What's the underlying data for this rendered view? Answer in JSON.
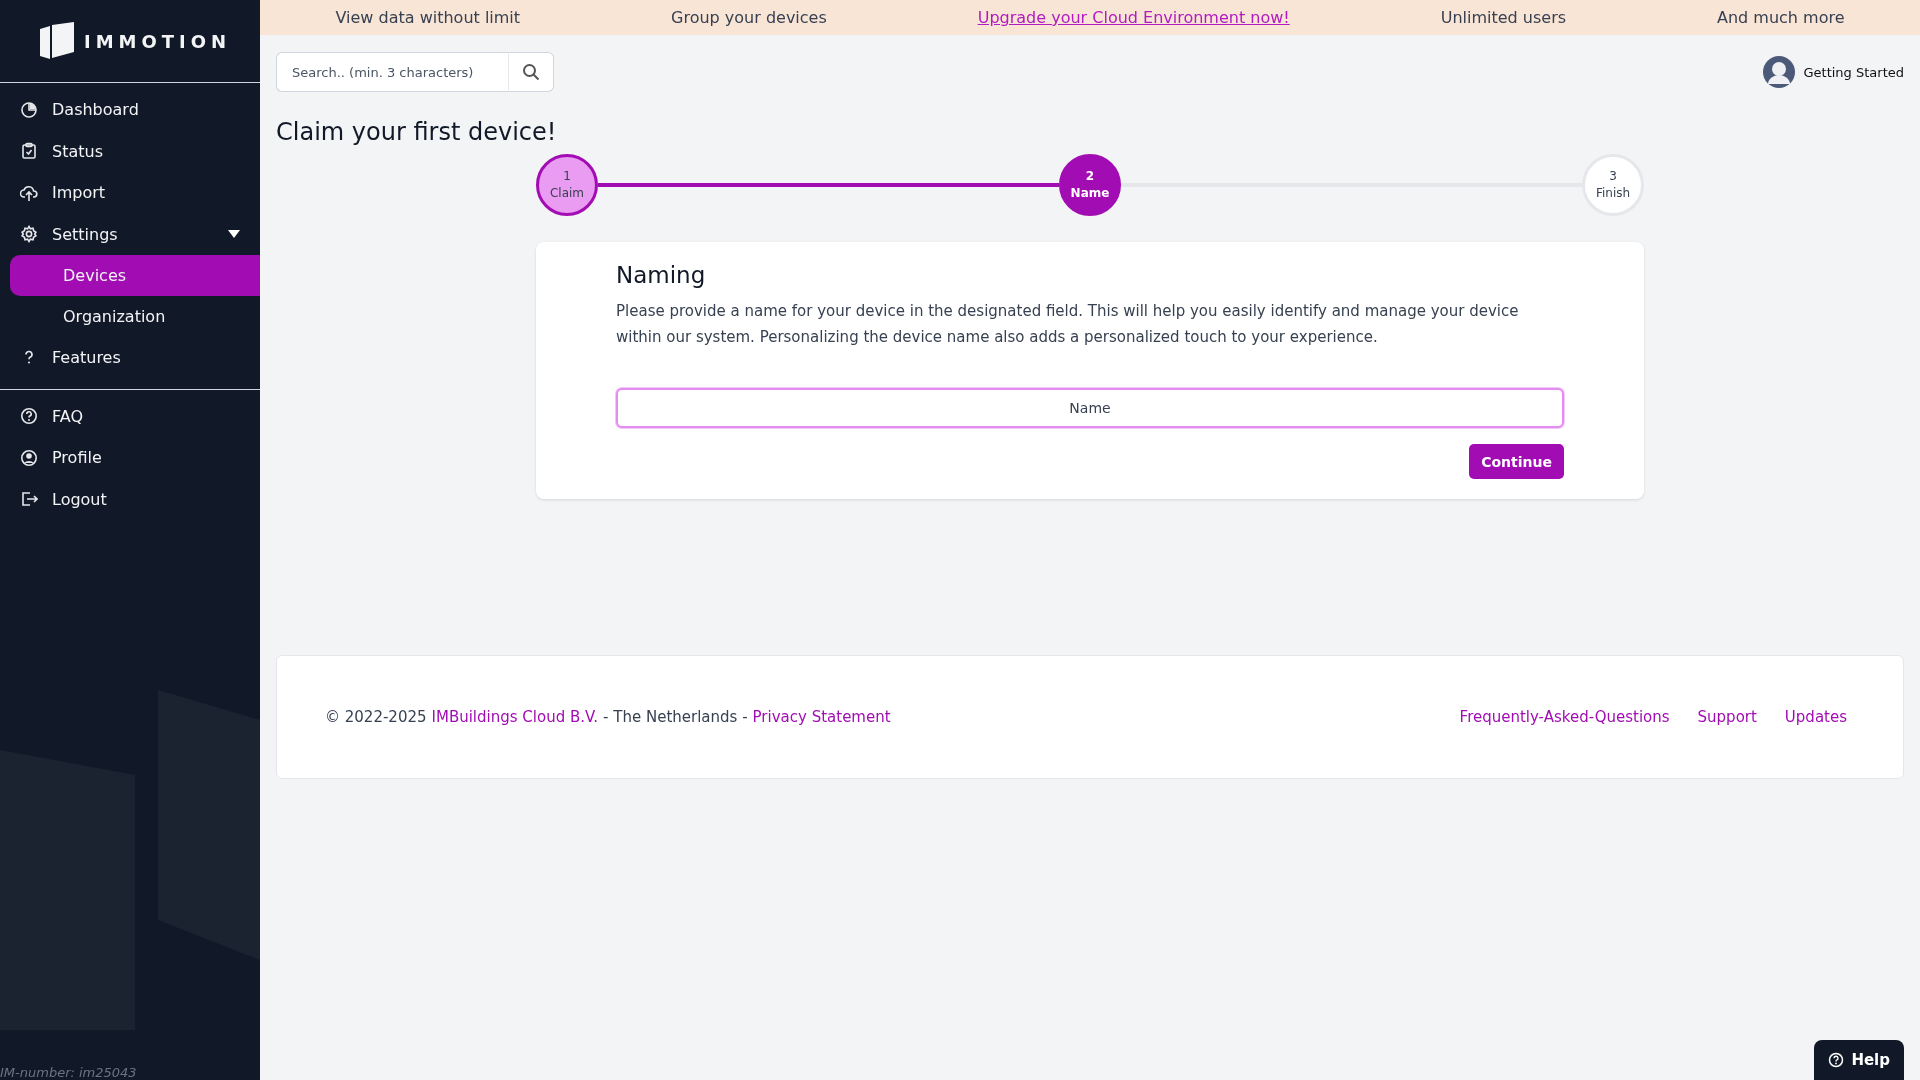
{
  "sidebar": {
    "logo": "IMMOTION",
    "groups": [
      {
        "items": [
          {
            "label": "Dashboard",
            "selected": false
          },
          {
            "label": "Status",
            "selected": false
          },
          {
            "label": "Import",
            "selected": false
          },
          {
            "label": "Settings",
            "selected": false,
            "expanded": true,
            "children": [
              {
                "label": "Devices",
                "selected": true
              },
              {
                "label": "Organization",
                "selected": false
              }
            ]
          },
          {
            "label": "Features",
            "selected": false
          }
        ]
      },
      {
        "items": [
          {
            "label": "FAQ",
            "selected": false
          },
          {
            "label": "Profile",
            "selected": false
          },
          {
            "label": "Logout",
            "selected": false
          }
        ]
      }
    ],
    "im_number": "IM-number: im25043"
  },
  "promo_bar": [
    {
      "text": "View data without limit",
      "kind": "text"
    },
    {
      "text": "Group your devices",
      "kind": "text"
    },
    {
      "text": "Upgrade your Cloud Environment now!",
      "kind": "link"
    },
    {
      "text": "Unlimited users",
      "kind": "text"
    },
    {
      "text": "And much more",
      "kind": "text"
    }
  ],
  "search": {
    "placeholder": "Search.. (min. 3 characters)"
  },
  "user": {
    "label": "Getting Started"
  },
  "page_title": "Claim your first device!",
  "stepper": [
    {
      "number": "1",
      "label": "Claim",
      "completed": true,
      "selected": false
    },
    {
      "number": "2",
      "label": "Name",
      "completed": false,
      "selected": true
    },
    {
      "number": "3",
      "label": "Finish",
      "completed": false,
      "selected": false
    }
  ],
  "card": {
    "title": "Naming",
    "description": "Please provide a name for your device in the designated field. This will help you easily identify and manage your device within our system. Personalizing the device name also adds a personalized touch to your experience.",
    "name_field": {
      "placeholder": "Name",
      "focused": true
    },
    "button": "Continue"
  },
  "footer": {
    "parts": [
      {
        "text": "© 2022-2025",
        "kind": "text"
      },
      {
        "text": "IMBuildings Cloud B.V.",
        "kind": "link"
      },
      {
        "text": "- The Netherlands -",
        "kind": "text"
      },
      {
        "text": "Privacy Statement",
        "kind": "link"
      }
    ],
    "links": [
      "Frequently-Asked-Questions",
      "Support",
      "Updates"
    ]
  },
  "help_button": "Help"
}
